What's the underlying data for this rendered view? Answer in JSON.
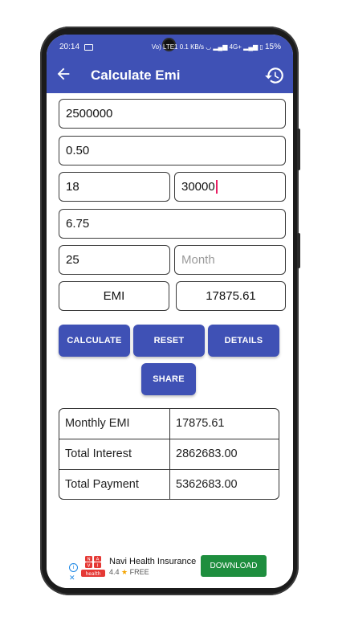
{
  "status_bar": {
    "time": "20:14",
    "signal_text": "Vo) LTE1 0.1 KB/s",
    "network": "4G+",
    "battery": "15%"
  },
  "app_bar": {
    "title": "Calculate Emi",
    "color": "#3f51b5"
  },
  "inputs": {
    "loan_amount": "2500000",
    "processing_fee": "0.50",
    "field_a": "18",
    "field_b": "30000",
    "interest_rate": "6.75",
    "tenure": "25",
    "tenure_unit_placeholder": "Month",
    "result_label": "EMI",
    "result_value": "17875.61"
  },
  "buttons": {
    "calculate": "CALCULATE",
    "reset": "RESET",
    "details": "DETAILS",
    "share": "SHARE"
  },
  "results": [
    {
      "label": "Monthly EMI",
      "value": "17875.61"
    },
    {
      "label": "Total Interest",
      "value": "2862683.00"
    },
    {
      "label": "Total Payment",
      "value": "5362683.00"
    }
  ],
  "ad": {
    "app_name": "Navi Health Insurance",
    "rating": "4.4",
    "price": "FREE",
    "cta": "DOWNLOAD",
    "logo_text": "health",
    "logo_letters": [
      "N",
      "A",
      "V",
      "I"
    ]
  }
}
